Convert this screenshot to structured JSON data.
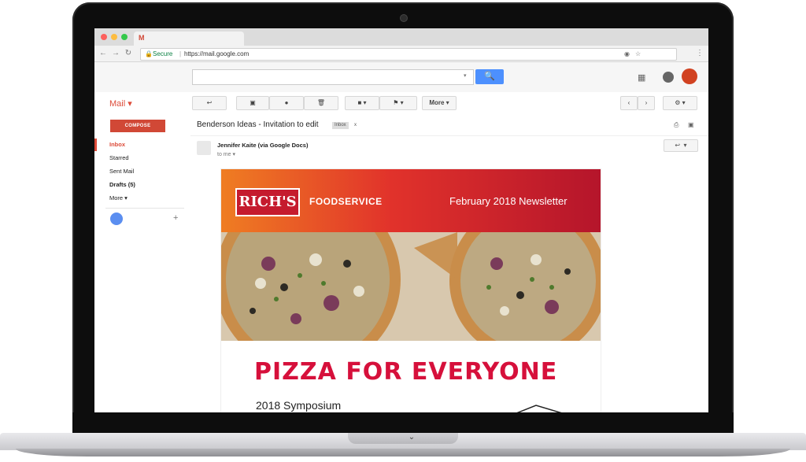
{
  "browser": {
    "tab_icon": "gmail-icon",
    "secure_label": "Secure",
    "url": "https://mail.google.com"
  },
  "gmail": {
    "app_label": "Mail",
    "toolbar": {
      "more_label": "More"
    },
    "sidebar": {
      "compose": "COMPOSE",
      "items": [
        "Inbox",
        "Starred",
        "Sent Mail",
        "Drafts (5)",
        "More"
      ]
    },
    "message": {
      "subject": "Benderson Ideas - Invitation to edit",
      "label_badge": "Inbox",
      "label_close": "x",
      "sender": "Jennifer Kaite (via Google Docs)",
      "to": "to me"
    }
  },
  "newsletter": {
    "logo_text": "RICH'S",
    "brand": "FOODSERVICE",
    "issue": "February 2018 Newsletter",
    "headline": "PIZZA FOR EVERYONE",
    "subhead": "2018 Symposium"
  },
  "colors": {
    "gmail_red": "#dd4b39",
    "compose_red": "#d14836",
    "search_blue": "#4d90fe",
    "headline_red": "#d6103b"
  }
}
